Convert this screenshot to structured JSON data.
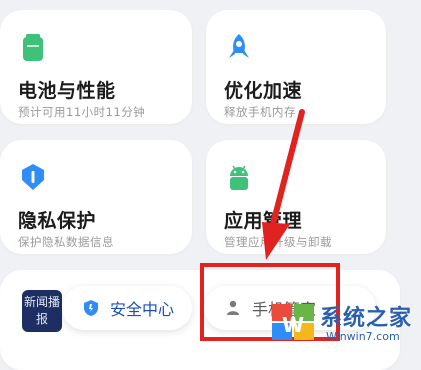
{
  "cards": [
    {
      "title": "电池与性能",
      "subtitle": "预计可用11小时11分钟",
      "icon": "battery-icon",
      "color": "#3ec27a"
    },
    {
      "title": "优化加速",
      "subtitle": "释放手机内存",
      "icon": "rocket-icon",
      "color": "#2f8ef5"
    },
    {
      "title": "隐私保护",
      "subtitle": "保护隐私数据信息",
      "icon": "privacy-shield-icon",
      "color": "#2f8ef5"
    },
    {
      "title": "应用管理",
      "subtitle": "管理应用升级与卸载",
      "icon": "android-app-icon",
      "color": "#3ec27a"
    }
  ],
  "bottom_bar": {
    "news_thumb": "新闻播报",
    "security_center": "安全中心",
    "phone_manager": "手机管家"
  },
  "watermark": {
    "text": "系统之家",
    "url": "Winwin7.com",
    "logo_letter": "W"
  },
  "annotation": {
    "box_color": "#e1231f",
    "arrow_color": "#e1231f"
  }
}
